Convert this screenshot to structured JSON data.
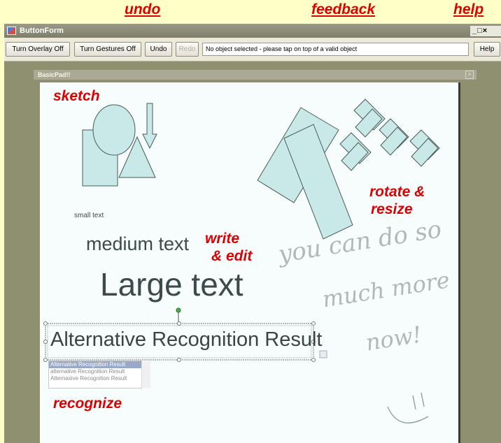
{
  "callouts": {
    "undo": "undo",
    "feedback": "feedback",
    "help": "help",
    "sketch": "sketch",
    "rotate_resize_line1": "rotate &",
    "rotate_resize_line2": "resize",
    "write_edit_line1": "write",
    "write_edit_line2": "& edit",
    "recognize": "recognize"
  },
  "window": {
    "title": "ButtonForm",
    "controls": "_□×"
  },
  "toolbar": {
    "overlay_label": "Turn Overlay Off",
    "gestures_label": "Turn Gestures Off",
    "undo_label": "Undo",
    "redo_label": "Redo",
    "feedback_text": "No object selected - please tap on top of a valid object",
    "help_label": "Help"
  },
  "child_window": {
    "title": "BasicPad!!",
    "close": "×"
  },
  "canvas": {
    "small_text": "small text",
    "medium_text": "medium text",
    "large_text": "Large text",
    "recognition_result": "Alternative Recognition Result",
    "handwriting_line1": "you can do so",
    "handwriting_line2": "much more",
    "handwriting_line3": "now!"
  },
  "alternatives": {
    "items": [
      "Alternative Recognition Result",
      "alternative Recognition Result",
      "Atternaxive Recognition Result"
    ]
  },
  "colors": {
    "callout": "#e00000",
    "shape_fill": "#c9e9e9",
    "shape_stroke": "#4a5a5a",
    "window_bg": "#8f9070"
  }
}
